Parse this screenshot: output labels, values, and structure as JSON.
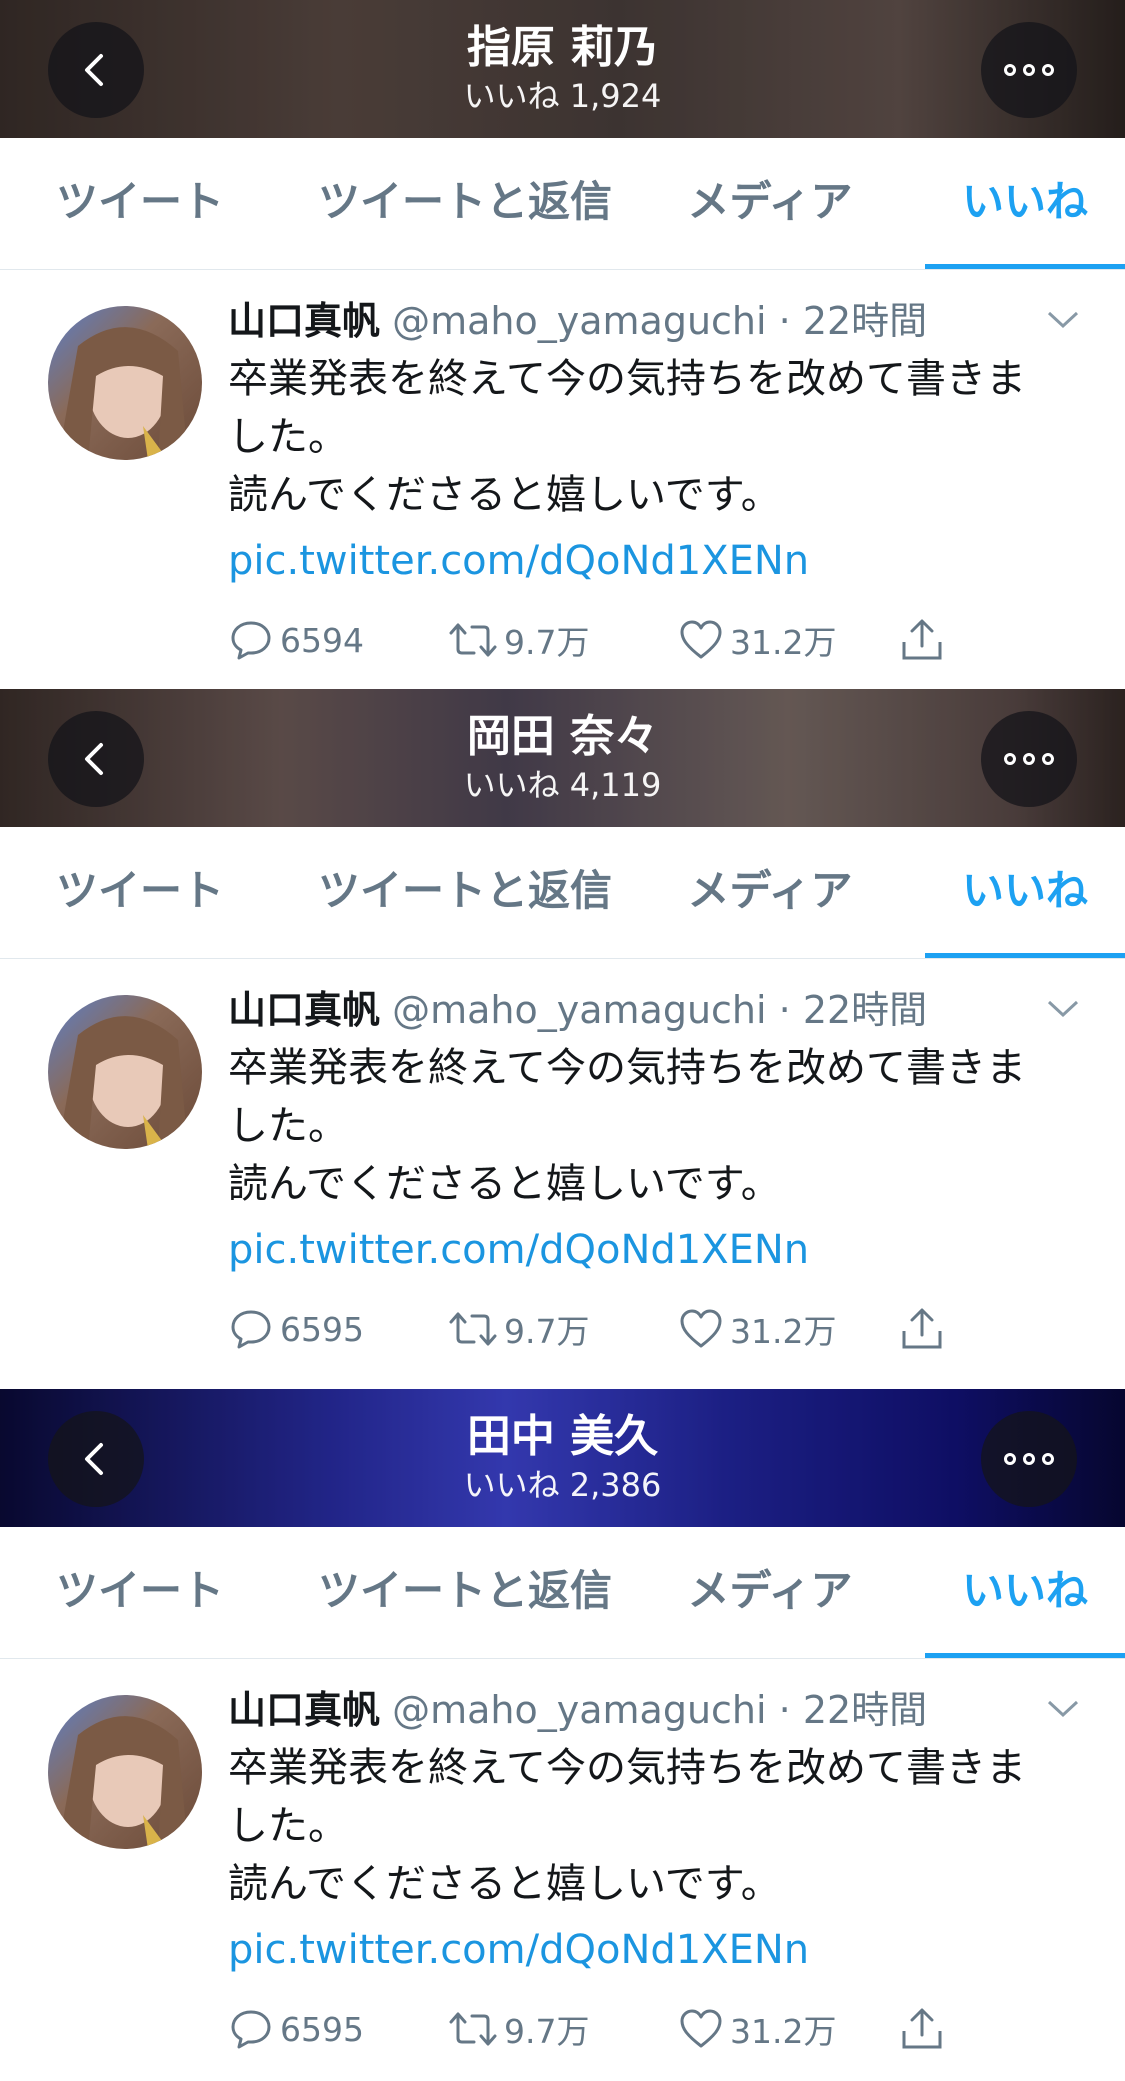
{
  "panels": [
    {
      "header": {
        "title": "指原 莉乃",
        "subtitle": "いいね 1,924"
      },
      "tabs": [
        "ツイート",
        "ツイートと返信",
        "メディア",
        "いいね"
      ],
      "tweet": {
        "name": "山口真帆",
        "handle": "@maho_yamaguchi",
        "time": "· 22時間",
        "text_line1": "卒業発表を終えて今の気持ちを改めて書きま",
        "text_line2": "した。",
        "text_line3": "読んでくださると嬉しいです。",
        "link": "pic.twitter.com/dQoNd1XENn",
        "replies": "6594",
        "retweets": "9.7万",
        "likes": "31.2万"
      }
    },
    {
      "header": {
        "title": "岡田 奈々",
        "subtitle": "いいね 4,119"
      },
      "tabs": [
        "ツイート",
        "ツイートと返信",
        "メディア",
        "いいね"
      ],
      "tweet": {
        "name": "山口真帆",
        "handle": "@maho_yamaguchi",
        "time": "· 22時間",
        "text_line1": "卒業発表を終えて今の気持ちを改めて書きま",
        "text_line2": "した。",
        "text_line3": "読んでくださると嬉しいです。",
        "link": "pic.twitter.com/dQoNd1XENn",
        "replies": "6595",
        "retweets": "9.7万",
        "likes": "31.2万"
      }
    },
    {
      "header": {
        "title": "田中 美久",
        "subtitle": "いいね 2,386"
      },
      "tabs": [
        "ツイート",
        "ツイートと返信",
        "メディア",
        "いいね"
      ],
      "tweet": {
        "name": "山口真帆",
        "handle": "@maho_yamaguchi",
        "time": "· 22時間",
        "text_line1": "卒業発表を終えて今の気持ちを改めて書きま",
        "text_line2": "した。",
        "text_line3": "読んでくださると嬉しいです。",
        "link": "pic.twitter.com/dQoNd1XENn",
        "replies": "6595",
        "retweets": "9.7万",
        "likes": "31.2万"
      }
    }
  ],
  "colors": {
    "accent": "#1da1f2",
    "link": "#1b95e0",
    "muted": "#657786"
  },
  "icons": [
    "back-icon",
    "more-icon",
    "caret-down-icon",
    "reply-icon",
    "retweet-icon",
    "like-icon",
    "share-icon"
  ]
}
